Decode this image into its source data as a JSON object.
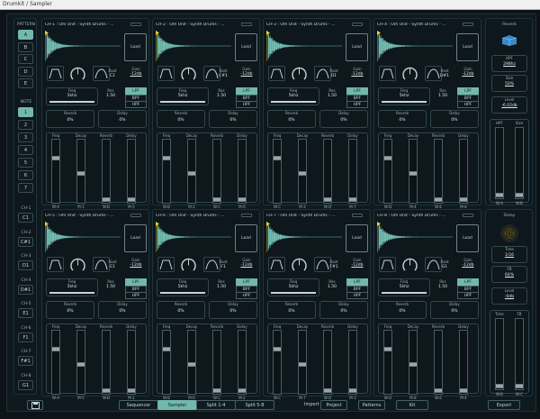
{
  "window": {
    "title": "Drumkit / Sampler"
  },
  "pattern": {
    "label": "PATTERN",
    "items": [
      "A",
      "B",
      "C",
      "D",
      "E"
    ],
    "selected": 0
  },
  "note": {
    "label": "NOTE",
    "items": [
      "1",
      "2",
      "3",
      "4",
      "5",
      "6",
      "7"
    ],
    "selected": 0
  },
  "channel_notes": [
    {
      "ch": "CH-1",
      "note": "C1"
    },
    {
      "ch": "CH-2",
      "note": "C#1"
    },
    {
      "ch": "CH-3",
      "note": "D1"
    },
    {
      "ch": "CH-4",
      "note": "D#1"
    },
    {
      "ch": "CH-5",
      "note": "E1"
    },
    {
      "ch": "CH-6",
      "note": "F1"
    },
    {
      "ch": "CH-7",
      "note": "F#1"
    },
    {
      "ch": "CH-8",
      "note": "G1"
    }
  ],
  "labels": {
    "load": "Load",
    "root": "Root",
    "gain": "Gain",
    "freq": "Freq",
    "res": "Res",
    "reverb": "Reverb",
    "delay": "Delay",
    "filters": [
      "LPF",
      "BPF",
      "HPF"
    ],
    "fader_labels": [
      "Freq",
      "Decay",
      "Reverb",
      "Delay"
    ]
  },
  "channels": [
    {
      "title": "CH-1 : Om Unit - Synth Drums - ...",
      "root": "C1",
      "gain": "-12db",
      "freq": "5khz",
      "res": "1.50",
      "filter": "LPF",
      "reverb": "0%",
      "delay": "0%",
      "faders": [
        0.28,
        0.55,
        1.0,
        1.0
      ],
      "fader_tags": [
        "W-A",
        "M-1",
        "W-B",
        "M-5"
      ]
    },
    {
      "title": "CH-2 : Om Unit - Synth Drums - ...",
      "root": "C#1",
      "gain": "-12db",
      "freq": "5khz",
      "res": "1.50",
      "filter": "LPF",
      "reverb": "0%",
      "delay": "0%",
      "faders": [
        0.28,
        0.55,
        1.0,
        1.0
      ],
      "fader_tags": [
        "W-B",
        "M-2",
        "W-C",
        "M-6"
      ]
    },
    {
      "title": "CH-3 : Om Unit - Synth Drums - ...",
      "root": "D1",
      "gain": "-12db",
      "freq": "5khz",
      "res": "1.50",
      "filter": "LPF",
      "reverb": "0%",
      "delay": "0%",
      "faders": [
        0.28,
        0.55,
        1.0,
        1.0
      ],
      "fader_tags": [
        "W-C",
        "M-3",
        "W-D",
        "M-7"
      ]
    },
    {
      "title": "CH-4 : Om Unit - Synth Drums - ...",
      "root": "D#1",
      "gain": "-12db",
      "freq": "5khz",
      "res": "1.50",
      "filter": "LPF",
      "reverb": "0%",
      "delay": "0%",
      "faders": [
        0.28,
        0.55,
        1.0,
        1.0
      ],
      "fader_tags": [
        "W-D",
        "M-4",
        "W-E",
        "M-8"
      ]
    },
    {
      "title": "CH-5 : Om Unit - Synth Drums - ...",
      "root": "E1",
      "gain": "-12db",
      "freq": "5khz",
      "res": "1.50",
      "filter": "LPF",
      "reverb": "0%",
      "delay": "0%",
      "faders": [
        0.28,
        0.55,
        1.0,
        1.0
      ],
      "fader_tags": [
        "W-A",
        "M-5",
        "W-B",
        "M-1"
      ]
    },
    {
      "title": "CH-6 : Om Unit - Synth Drums - ...",
      "root": "F1",
      "gain": "-12db",
      "freq": "5khz",
      "res": "1.50",
      "filter": "LPF",
      "reverb": "0%",
      "delay": "0%",
      "faders": [
        0.28,
        0.55,
        1.0,
        1.0
      ],
      "fader_tags": [
        "W-B",
        "M-6",
        "W-C",
        "M-2"
      ]
    },
    {
      "title": "CH-7 : Om Unit - Synth Drums - ...",
      "root": "F#1",
      "gain": "-12db",
      "freq": "5khz",
      "res": "1.50",
      "filter": "LPF",
      "reverb": "0%",
      "delay": "0%",
      "faders": [
        0.28,
        0.55,
        1.0,
        1.0
      ],
      "fader_tags": [
        "W-C",
        "M-7",
        "W-D",
        "M-3"
      ]
    },
    {
      "title": "CH-8 : Om Unit - Synth Drums - ...",
      "root": "G1",
      "gain": "-12db",
      "freq": "5khz",
      "res": "1.50",
      "filter": "LPF",
      "reverb": "0%",
      "delay": "0%",
      "faders": [
        0.28,
        0.55,
        1.0,
        1.0
      ],
      "fader_tags": [
        "W-D",
        "M-8",
        "W-E",
        "M-4"
      ]
    }
  ],
  "reverb_panel": {
    "title": "Reverb",
    "hpf_label": "HPF",
    "hpf": "298hz",
    "size_label": "Size",
    "size": "50%",
    "level_label": "Level",
    "level": "-6.02db",
    "fader_labels": [
      "HPF",
      "Size"
    ],
    "fader_tags": [
      "W-A",
      "W-B"
    ]
  },
  "delay_panel": {
    "title": "Delay",
    "time_label": "Time",
    "time": "1/16",
    "fb_label": "FB",
    "fb": "64%",
    "level_label": "Level",
    "level": "-0db",
    "fader_labels": [
      "Time",
      "FB"
    ],
    "fader_tags": [
      "W-B",
      "W-C"
    ]
  },
  "bottom": {
    "sequencer": "Sequencer",
    "sampler": "Sampler",
    "split14": "Split 1-4",
    "split58": "Split 5-8",
    "import_label": "Import",
    "project": "Project",
    "patterns": "Patterns",
    "kit": "Kit",
    "export": "Export"
  },
  "colors": {
    "accent": "#72b8ac",
    "wave": "#7fd1c3",
    "marker": "#f2d21a",
    "delay_orb": "#d9a21c",
    "reverb_icon": "#3a89c9"
  }
}
